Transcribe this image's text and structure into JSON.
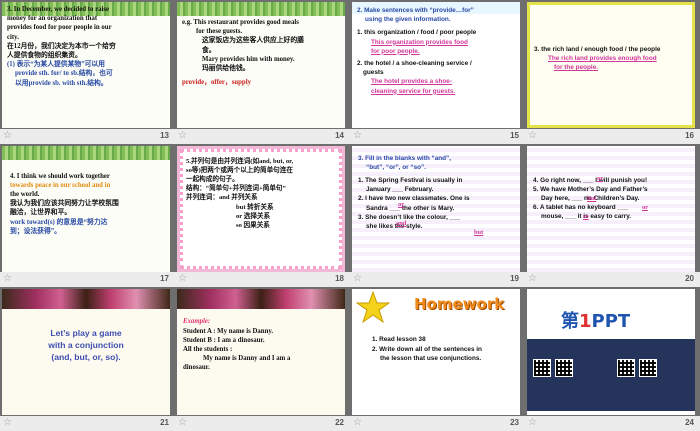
{
  "slides": [
    {
      "number": "13",
      "lines": [
        "3. In December, we decided to raise",
        "money for an organization  that",
        "provides food for poor people in our",
        "city.",
        "在12月份，我们决定为本市一个给穷",
        "人提供食物的组织集资。",
        "(1) 表示“为某人提供某物”可以用",
        "provide sth. for/ to sb.结构，也可",
        "以用provide sb. with sth.结构。"
      ]
    },
    {
      "number": "14",
      "lines": [
        "e.g. This restaurant provides good meals",
        "for these guests.",
        "这家饭店为这些客人供应上好的膳",
        "食。",
        "Mary provides him with money.",
        "玛丽供给他钱。",
        "provide，offer，supply"
      ]
    },
    {
      "number": "15",
      "lines": [
        "2. Make sentences with “provide…for”",
        "using the given information.",
        "1. this organization  / food / poor people",
        "This organization  provides food",
        "for poor people.",
        "2. the hotel / a shoe-cleaning service /",
        "guests",
        "The hotel provides a shoe-",
        "cleaning service for guests."
      ]
    },
    {
      "number": "16",
      "lines": [
        "3. the rich land / enough food / the people",
        "The rich land provides enough food",
        "for the people."
      ]
    },
    {
      "number": "17",
      "lines": [
        "4. I think we should work together",
        "towards peace in our school and in",
        "the world.",
        "我认为我们应该共同努力让学校氛围",
        "融洽，让世界和平。",
        "work toward(s) 的意思是“努力达",
        "到；设法获得”。"
      ]
    },
    {
      "number": "18",
      "lines": [
        "5.并列句是由并列连词(如and, but, or,",
        "so等)把两个或两个以上的简单句连在",
        "一起构成的句子。",
        "结构：“简单句+并列连词+简单句”",
        "并列连词：and      并列关系",
        "but      转折关系",
        "or       选择关系",
        "so       因果关系"
      ]
    },
    {
      "number": "19",
      "lines": [
        "3. Fill in the blanks with “and”,",
        "“but”, “or”, or “so”.",
        "1. The Spring Festival is usually in",
        "January ___ February.",
        "2. I have two new classmates. One is",
        "Sandra ___ the other is Mary.",
        "3. She doesn’t like the colour, ___",
        "she likes the style."
      ],
      "answers": [
        "or",
        "and",
        "but"
      ]
    },
    {
      "number": "20",
      "lines": [
        "4. Go right now, ___ I will punish you!",
        "5. We have Mother’s Day and Father’s",
        "Day here, ___ no Children’s Day.",
        "6. A tablet has no keyboard ___",
        "mouse, ___ it is easy to carry."
      ],
      "answers": [
        "or",
        "but",
        "or",
        "so"
      ]
    },
    {
      "number": "21",
      "lines": [
        "Let’s play a game",
        "with a conjunction",
        "(and, but, or, so)."
      ]
    },
    {
      "number": "22",
      "lines": [
        "Example:",
        "Student A :     My name is Danny.",
        "Student B :     I am a dinosaur.",
        "All the students :",
        "My name is Danny and  I am a",
        "dinosaur."
      ]
    },
    {
      "number": "23",
      "heading": "Homework",
      "lines": [
        "1. Read lesson 38",
        "2. Write down all of the sentences in",
        "the lesson that use conjunctions."
      ]
    },
    {
      "number": "24",
      "logo_prefix": "第",
      "logo_one": "1",
      "logo_suffix": "PPT"
    }
  ],
  "footer_icon": "star-icon",
  "colors": {
    "blue": "#2a4aa5",
    "pink": "#d2379a",
    "red": "#cc2020",
    "orange": "#e48a12"
  }
}
